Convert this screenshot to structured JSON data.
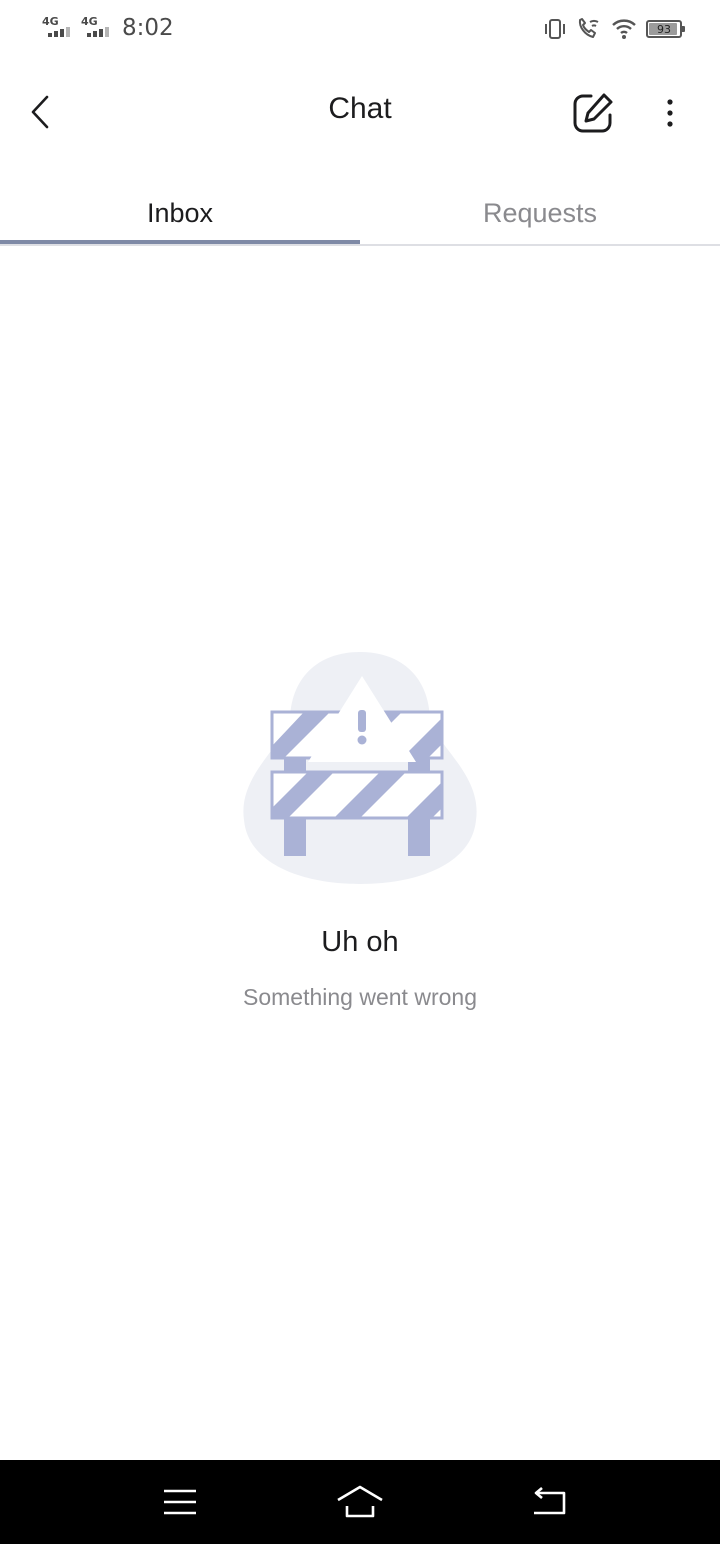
{
  "status_bar": {
    "network_1": "4G",
    "network_2": "4G",
    "time": "8:02",
    "battery_level": 93,
    "battery_text": "93",
    "icons": [
      "vibrate-icon",
      "wifi-call-icon",
      "wifi-icon",
      "battery-icon"
    ]
  },
  "header": {
    "title": "Chat",
    "icons": [
      "chevron-left-icon",
      "compose-icon",
      "more-vertical-icon"
    ]
  },
  "tabs": [
    {
      "label": "Inbox",
      "active": true
    },
    {
      "label": "Requests",
      "active": false
    }
  ],
  "error_state": {
    "title": "Uh oh",
    "message": "Something went wrong",
    "illustration": "roadblock-warning-illustration"
  },
  "nav_bar": {
    "icons": [
      "menu-icon",
      "home-icon",
      "back-icon"
    ]
  },
  "colors": {
    "accent": "#7f8aa6",
    "illustration_stripe": "#aab2d6",
    "illustration_blob": "#eef0f5",
    "muted_text": "#8a8a8e",
    "nav_bar": "#000000"
  }
}
